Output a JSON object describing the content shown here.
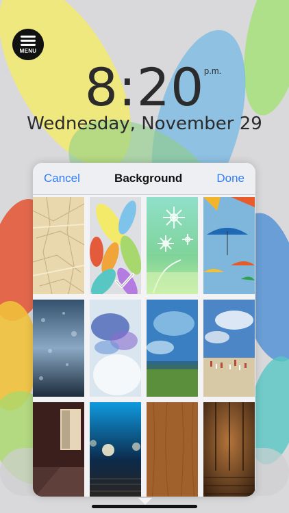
{
  "menu": {
    "label": "MENU",
    "icon": "hamburger-icon"
  },
  "clock": {
    "time": "8:20",
    "ampm": "p.m.",
    "date": "Wednesday, November 29"
  },
  "picker": {
    "cancel_label": "Cancel",
    "title": "Background",
    "done_label": "Done",
    "selected_index": 1,
    "tiles": [
      {
        "name": "crumpled-paper"
      },
      {
        "name": "colorful-petals"
      },
      {
        "name": "green-flowers"
      },
      {
        "name": "umbrellas"
      },
      {
        "name": "rain-glass"
      },
      {
        "name": "blue-smoke"
      },
      {
        "name": "painted-field"
      },
      {
        "name": "beach-painting"
      },
      {
        "name": "dark-room"
      },
      {
        "name": "bokeh-deck"
      },
      {
        "name": "wood-light"
      },
      {
        "name": "wood-dark"
      }
    ]
  },
  "colors": {
    "accent": "#2f7cf6"
  }
}
